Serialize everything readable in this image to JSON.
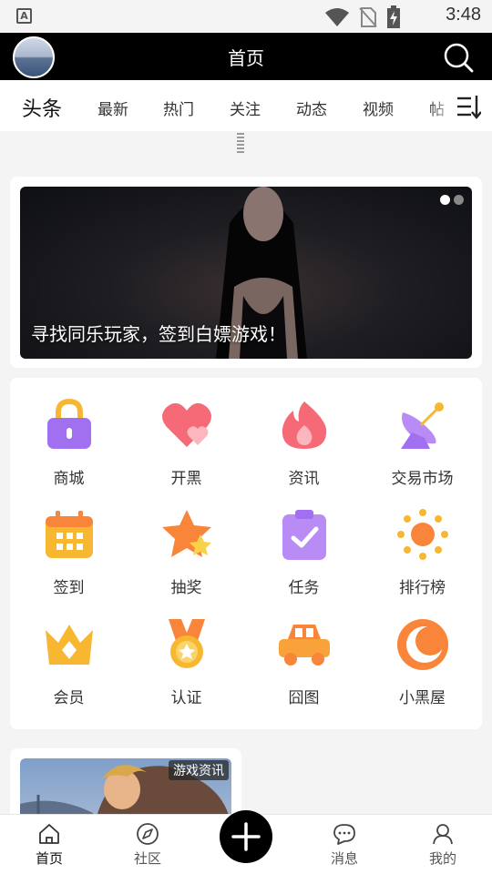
{
  "status_bar": {
    "time": "3:48",
    "notification_letter": "A"
  },
  "header": {
    "title": "首页"
  },
  "tabs": [
    {
      "label": "头条",
      "active": true
    },
    {
      "label": "最新"
    },
    {
      "label": "热门"
    },
    {
      "label": "关注"
    },
    {
      "label": "动态"
    },
    {
      "label": "视频"
    },
    {
      "label": "帖"
    }
  ],
  "banner": {
    "caption": "寻找同乐玩家，签到白嫖游戏！",
    "slide_index": 1,
    "slide_count": 2
  },
  "grid": [
    {
      "label": "商城",
      "icon": "lock-bag-icon",
      "color": "#a070f0"
    },
    {
      "label": "开黑",
      "icon": "heart-icon",
      "color": "#f66a78"
    },
    {
      "label": "资讯",
      "icon": "flame-icon",
      "color": "#f66a78"
    },
    {
      "label": "交易市场",
      "icon": "satellite-dish-icon",
      "color": "#a070f0"
    },
    {
      "label": "签到",
      "icon": "calendar-icon",
      "color": "#f7b731"
    },
    {
      "label": "抽奖",
      "icon": "star-icon",
      "color": "#f9853a"
    },
    {
      "label": "任务",
      "icon": "clipboard-check-icon",
      "color": "#b98cf5"
    },
    {
      "label": "排行榜",
      "icon": "sun-icon",
      "color": "#f9a23a"
    },
    {
      "label": "会员",
      "icon": "crown-icon",
      "color": "#f7b731"
    },
    {
      "label": "认证",
      "icon": "medal-icon",
      "color": "#f9a23a"
    },
    {
      "label": "囧图",
      "icon": "car-icon",
      "color": "#f9a23a"
    },
    {
      "label": "小黑屋",
      "icon": "moon-icon",
      "color": "#f9853a"
    }
  ],
  "news": {
    "tag": "游戏资讯"
  },
  "bottom_nav": [
    {
      "label": "首页",
      "icon": "home-icon",
      "active": true
    },
    {
      "label": "社区",
      "icon": "compass-icon"
    },
    {
      "label": "消息",
      "icon": "message-icon"
    },
    {
      "label": "我的",
      "icon": "profile-icon"
    }
  ]
}
